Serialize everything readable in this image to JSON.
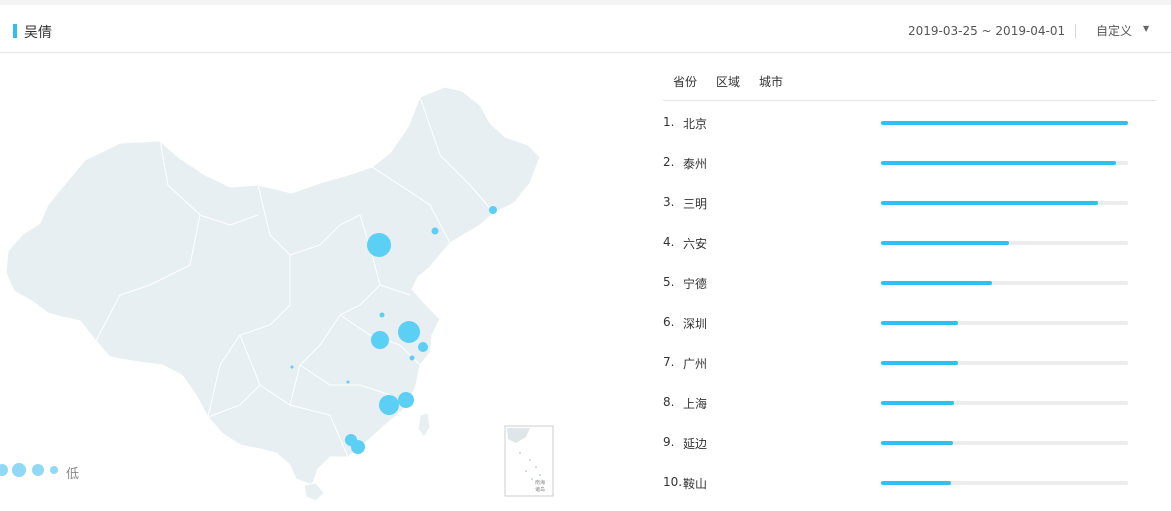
{
  "header": {
    "title": "吴倩",
    "date_range": "2019-03-25 ~ 2019-04-01",
    "range_select": "自定义"
  },
  "map": {
    "legend_low": "低",
    "inset_label_1": "南海",
    "inset_label_2": "诸岛"
  },
  "tabs": [
    "省份",
    "区域",
    "城市"
  ],
  "ranking": [
    {
      "rank": "1.",
      "city": "北京",
      "value": 1.0
    },
    {
      "rank": "2.",
      "city": "泰州",
      "value": 0.95
    },
    {
      "rank": "3.",
      "city": "三明",
      "value": 0.88
    },
    {
      "rank": "4.",
      "city": "六安",
      "value": 0.52
    },
    {
      "rank": "5.",
      "city": "宁德",
      "value": 0.45
    },
    {
      "rank": "6.",
      "city": "深圳",
      "value": 0.31
    },
    {
      "rank": "7.",
      "city": "广州",
      "value": 0.31
    },
    {
      "rank": "8.",
      "city": "上海",
      "value": 0.295
    },
    {
      "rank": "9.",
      "city": "延边",
      "value": 0.29
    },
    {
      "rank": "10.",
      "city": "鞍山",
      "value": 0.285
    }
  ],
  "colors": {
    "accent": "#2ec0f0",
    "bubble": "#5ccff5",
    "land": "#e8eff2"
  }
}
